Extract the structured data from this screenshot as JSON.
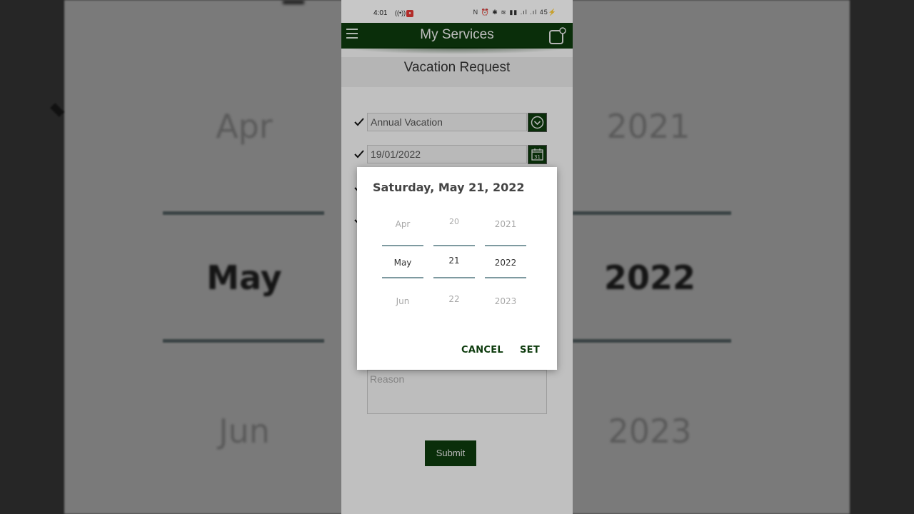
{
  "status_bar": {
    "time": "4:01",
    "battery": "45"
  },
  "app_bar": {
    "title": "My Services"
  },
  "page": {
    "title": "Vacation Request"
  },
  "form": {
    "vacation_type": "Annual Vacation",
    "start_date": "19/01/2022",
    "reason_placeholder": "Reason",
    "submit_label": "Submit"
  },
  "date_dialog": {
    "title": "Saturday, May 21, 2022",
    "month": {
      "prev": "Apr",
      "selected": "May",
      "next": "Jun"
    },
    "day": {
      "prev": "20",
      "selected": "21",
      "next": "22"
    },
    "year": {
      "prev": "2021",
      "selected": "2022",
      "next": "2023"
    },
    "cancel_label": "CANCEL",
    "set_label": "SET"
  },
  "colors": {
    "brand_green": "#0d3b0d",
    "picker_line": "#7e9aa0"
  },
  "icons": [
    "menu-icon",
    "notification-icon",
    "check-icon",
    "dropdown-icon",
    "calendar-icon"
  ]
}
